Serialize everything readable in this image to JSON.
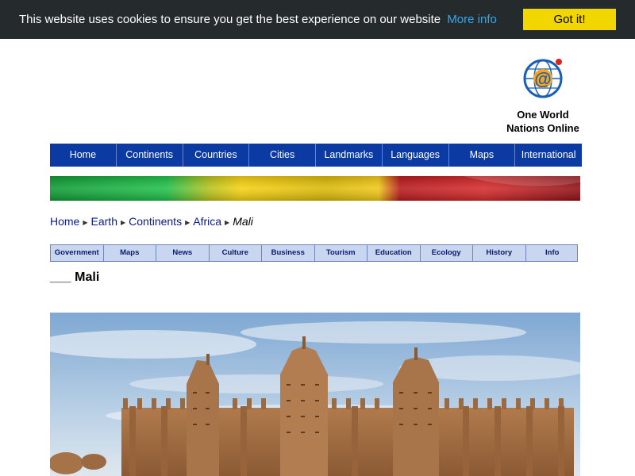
{
  "cookie_bar": {
    "message": "This website uses cookies to ensure you get the best experience on our website",
    "more_info": "More info",
    "got_it": "Got it!"
  },
  "site": {
    "logo_line1": "One World",
    "logo_line2": "Nations Online",
    "logo_icon": "at-globe-icon"
  },
  "main_nav": [
    "Home",
    "Continents",
    "Countries",
    "Cities",
    "Landmarks",
    "Languages",
    "Maps",
    "International"
  ],
  "breadcrumb": {
    "items": [
      "Home",
      "Earth",
      "Continents",
      "Africa"
    ],
    "current": "Mali",
    "separator_icon": "triangle-right-icon"
  },
  "sub_nav": [
    "Government",
    "Maps",
    "News",
    "Culture",
    "Business",
    "Tourism",
    "Education",
    "Ecology",
    "History",
    "Info"
  ],
  "page": {
    "title": "___ Mali"
  },
  "colors": {
    "cookie_bg": "#252a2d",
    "cookie_link": "#31a8f0",
    "cookie_button": "#f1d600",
    "nav_bg": "#0b3aa3",
    "sub_nav_bg": "#c8d6f0",
    "flag_green": "#14b53a",
    "flag_yellow": "#fcd116",
    "flag_red": "#ce1126"
  }
}
